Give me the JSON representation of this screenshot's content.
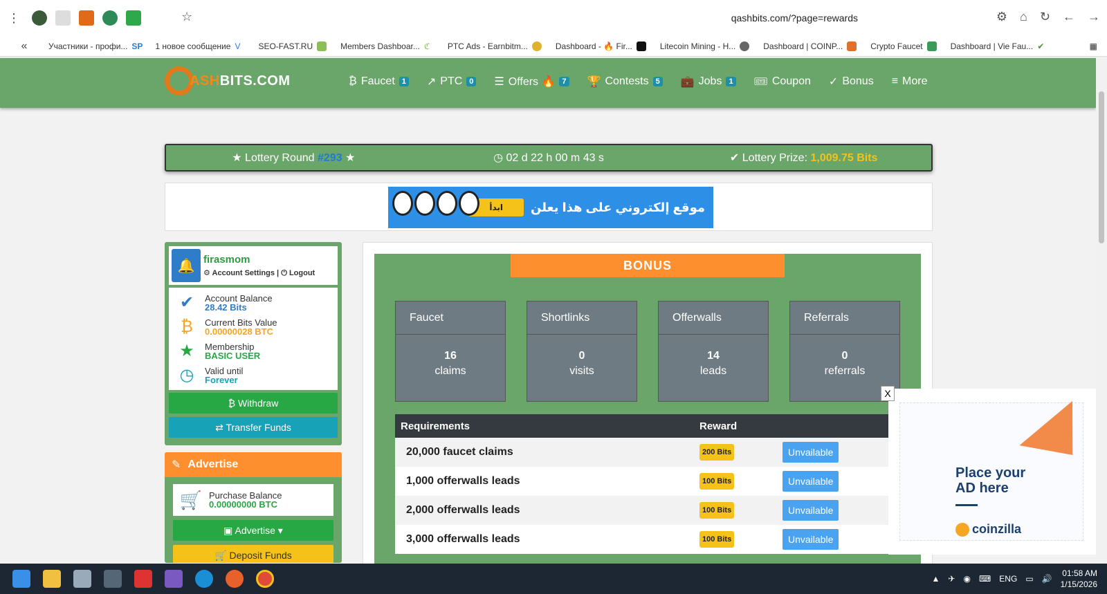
{
  "browser": {
    "url": "qashbits.com/?page=rewards",
    "bookmarks": [
      {
        "label": "Участники - профи..."
      },
      {
        "label": "1 новое сообщение"
      },
      {
        "label": "SEO-FAST.RU"
      },
      {
        "label": "Members Dashboar..."
      },
      {
        "label": "PTC Ads - Earnbitm..."
      },
      {
        "label": "Dashboard - 🔥 Fir..."
      },
      {
        "label": "Litecoin Mining - H..."
      },
      {
        "label": "Dashboard | COINP..."
      },
      {
        "label": "Crypto Faucet"
      },
      {
        "label": "Dashboard | Vie Fau..."
      }
    ]
  },
  "site": {
    "logo_prefix": "Q",
    "logo_ash": "ASH",
    "logo_rest": "BITS.COM",
    "menu": [
      {
        "label": "Faucet",
        "badge": "1"
      },
      {
        "label": "PTC",
        "badge": "0"
      },
      {
        "label": "Offers 🔥",
        "badge": "7"
      },
      {
        "label": "Contests",
        "badge": "5"
      },
      {
        "label": "Jobs",
        "badge": "1"
      },
      {
        "label": "Coupon",
        "badge": ""
      },
      {
        "label": "Bonus",
        "badge": ""
      },
      {
        "label": "More",
        "badge": ""
      }
    ]
  },
  "lottery": {
    "round_label": "Lottery Round",
    "round_number": "#293",
    "countdown": "02 d 22 h 00 m 43 s",
    "prize_label": "Lottery Prize:",
    "prize_value": "1,009.75 Bits"
  },
  "ad_banner": {
    "text": "موقع إلكتروني على هذا يعلن",
    "button": "ابدأ"
  },
  "profile": {
    "username": "firasmom",
    "account_settings": "Account Settings",
    "logout": "Logout",
    "stats": [
      {
        "label": "Account Balance",
        "value": "28.42 Bits",
        "color": "#2f7dc9"
      },
      {
        "label": "Current Bits Value",
        "value": "0.00000028 BTC",
        "color": "#f5a623"
      },
      {
        "label": "Membership",
        "value": "BASIC USER",
        "color": "#28a745"
      },
      {
        "label": "Valid until",
        "value": "Forever",
        "color": "#17a2b8"
      }
    ],
    "withdraw": "Withdraw",
    "transfer": "Transfer Funds"
  },
  "advertise": {
    "title": "Advertise",
    "purchase_label": "Purchase Balance",
    "purchase_value": "0.00000000 BTC",
    "advertise_btn": "Advertise",
    "deposit_btn": "Deposit Funds"
  },
  "bonus": {
    "title": "BONUS",
    "cards": [
      {
        "title": "Faucet",
        "value": "16",
        "unit": "claims"
      },
      {
        "title": "Shortlinks",
        "value": "0",
        "unit": "visits"
      },
      {
        "title": "Offerwalls",
        "value": "14",
        "unit": "leads"
      },
      {
        "title": "Referrals",
        "value": "0",
        "unit": "referrals"
      }
    ],
    "headers": {
      "requirements": "Requirements",
      "reward": "Reward"
    },
    "rows": [
      {
        "requirement": "20,000 faucet claims",
        "reward": "200 Bits",
        "action": "Unvailable"
      },
      {
        "requirement": "1,000 offerwalls leads",
        "reward": "100 Bits",
        "action": "Unvailable"
      },
      {
        "requirement": "2,000 offerwalls leads",
        "reward": "100 Bits",
        "action": "Unvailable"
      },
      {
        "requirement": "3,000 offerwalls leads",
        "reward": "100 Bits",
        "action": "Unvailable"
      }
    ]
  },
  "coinzilla": {
    "close": "X",
    "place_line1": "Place your",
    "place_line2": "AD here",
    "brand": "coinzilla"
  },
  "taskbar": {
    "lang": "ENG",
    "time": "01:58 AM",
    "date": "1/15/2026"
  }
}
